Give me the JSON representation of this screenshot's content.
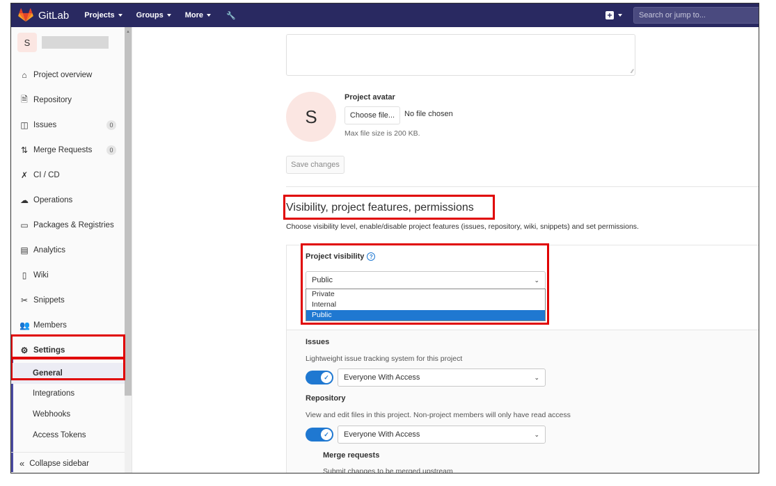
{
  "topnav": {
    "brand": "GitLab",
    "menus": [
      "Projects",
      "Groups",
      "More"
    ],
    "search_placeholder": "Search or jump to..."
  },
  "sidebar": {
    "project_initial": "S",
    "items": [
      {
        "label": "Project overview"
      },
      {
        "label": "Repository"
      },
      {
        "label": "Issues",
        "badge": "0"
      },
      {
        "label": "Merge Requests",
        "badge": "0"
      },
      {
        "label": "CI / CD"
      },
      {
        "label": "Operations"
      },
      {
        "label": "Packages & Registries"
      },
      {
        "label": "Analytics"
      },
      {
        "label": "Wiki"
      },
      {
        "label": "Snippets"
      },
      {
        "label": "Members"
      },
      {
        "label": "Settings"
      }
    ],
    "settings_sub": [
      "General",
      "Integrations",
      "Webhooks",
      "Access Tokens"
    ],
    "collapse": "Collapse sidebar"
  },
  "main": {
    "avatar_initial": "S",
    "avatar_label": "Project avatar",
    "choose_file": "Choose file...",
    "no_file": "No file chosen",
    "max_size": "Max file size is 200 KB.",
    "save": "Save changes",
    "section_title": "Visibility, project features, permissions",
    "section_desc": "Choose visibility level, enable/disable project features (issues, repository, wiki, snippets) and set permissions.",
    "visibility_label": "Project visibility",
    "visibility_value": "Public",
    "visibility_options": [
      "Private",
      "Internal",
      "Public"
    ],
    "issues_label": "Issues",
    "issues_desc": "Lightweight issue tracking system for this project",
    "issues_access": "Everyone With Access",
    "repo_label": "Repository",
    "repo_desc": "View and edit files in this project. Non-project members will only have read access",
    "repo_access": "Everyone With Access",
    "mr_label": "Merge requests",
    "mr_desc": "Submit changes to be merged upstream"
  },
  "colors": {
    "nav": "#292961",
    "accent": "#1f78d1",
    "highlight": "#e00000"
  }
}
